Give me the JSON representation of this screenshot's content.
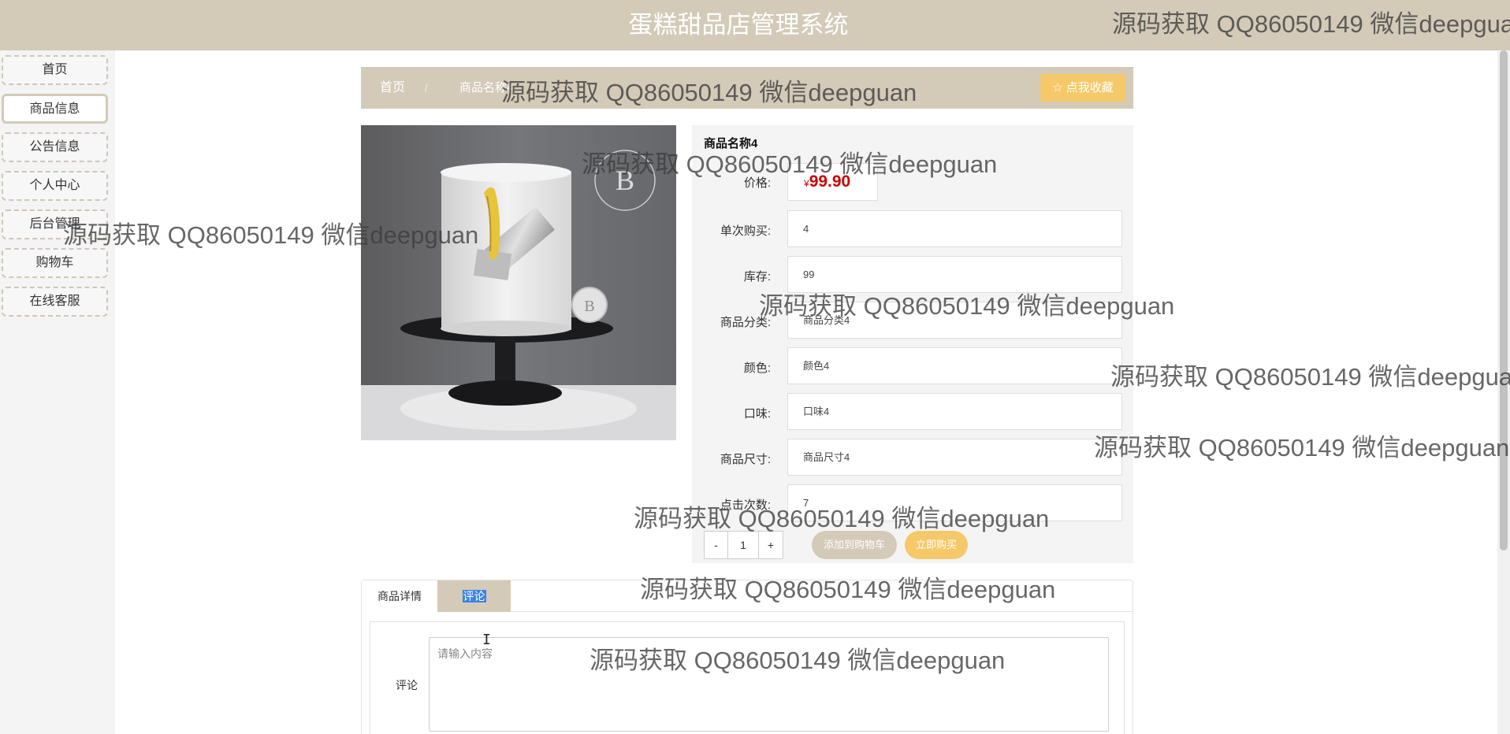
{
  "header": {
    "title": "蛋糕甜品店管理系统"
  },
  "sidebar": {
    "items": [
      {
        "label": "首页"
      },
      {
        "label": "商品信息"
      },
      {
        "label": "公告信息"
      },
      {
        "label": "个人中心"
      },
      {
        "label": "后台管理"
      },
      {
        "label": "购物车"
      },
      {
        "label": "在线客服"
      }
    ]
  },
  "breadcrumb": {
    "home": "首页",
    "separator": "/",
    "current": "商品名称4",
    "favorite_label": "☆ 点我收藏"
  },
  "product": {
    "name": "商品名称4",
    "price_label": "价格:",
    "currency": "¥",
    "price": "99.90",
    "fields": [
      {
        "label": "单次购买:",
        "value": "4"
      },
      {
        "label": "库存:",
        "value": "99"
      },
      {
        "label": "商品分类:",
        "value": "商品分类4"
      },
      {
        "label": "颜色:",
        "value": "颜色4"
      },
      {
        "label": "口味:",
        "value": "口味4"
      },
      {
        "label": "商品尺寸:",
        "value": "商品尺寸4"
      },
      {
        "label": "点击次数:",
        "value": "7"
      }
    ],
    "quantity": {
      "minus": "-",
      "value": "1",
      "plus": "+"
    },
    "add_to_cart_label": "添加到购物车",
    "buy_now_label": "立即购买"
  },
  "tabs": {
    "detail_label": "商品详情",
    "comment_label": "评论",
    "comment_field_label": "评论",
    "comment_placeholder": "请输入内容"
  },
  "watermark": {
    "text": "源码获取 QQ86050149 微信deepguan"
  },
  "colors": {
    "brand": "#d3cab8",
    "accent": "#f5c96a",
    "price": "#cc0000"
  }
}
